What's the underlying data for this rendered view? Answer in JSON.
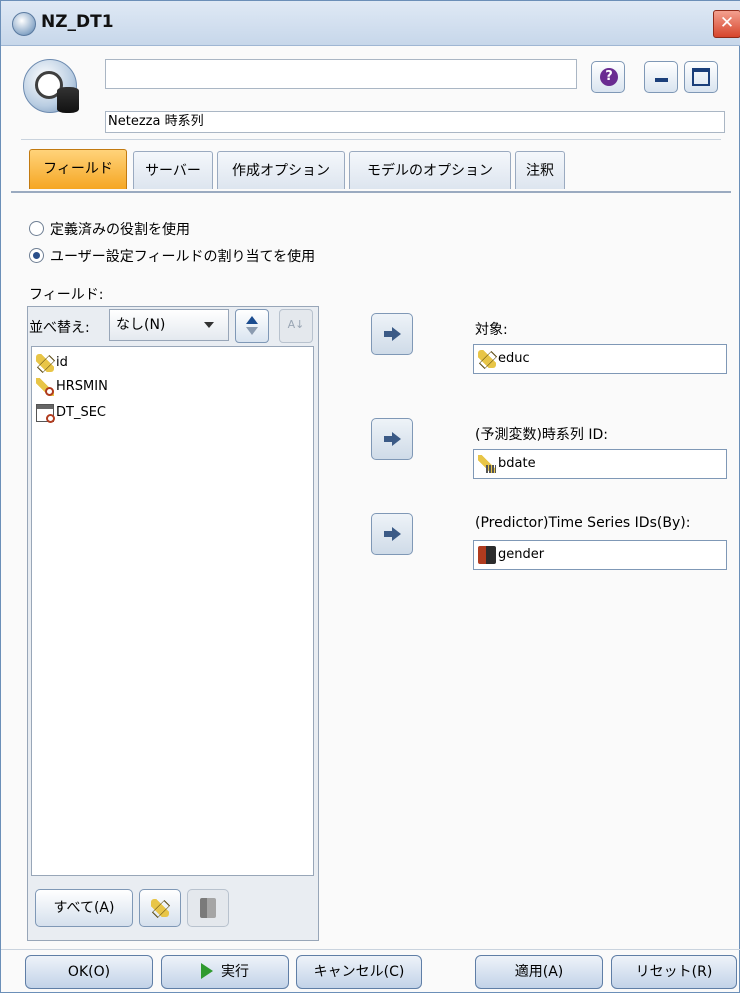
{
  "window": {
    "title": "NZ_DT1",
    "close_glyph": "✕"
  },
  "header": {
    "node_name_value": "",
    "node_type_label": "Netezza 時系列",
    "help_glyph": "?"
  },
  "tabs": [
    {
      "label": "フィールド",
      "active": true
    },
    {
      "label": "サーバー"
    },
    {
      "label": "作成オプション"
    },
    {
      "label": "モデルのオプション"
    },
    {
      "label": "注釈"
    }
  ],
  "roles": {
    "predefined": "定義済みの役割を使用",
    "custom": "ユーザー設定フィールドの割り当てを使用"
  },
  "fields_panel": {
    "label": "フィールド:",
    "sort_label": "並べ替え:",
    "sort_value": "なし(N)",
    "az_glyph": "A↓",
    "items": [
      {
        "name": "id",
        "icon": "continuous-ruler-icon"
      },
      {
        "name": "HRSMIN",
        "icon": "ordinal-time-icon"
      },
      {
        "name": "DT_SEC",
        "icon": "calendar-time-icon"
      }
    ],
    "all_button": "すべて(A)"
  },
  "targets": {
    "target_label": "対象:",
    "target_value": "educ",
    "tsid_label": "(予測変数)時系列 ID:",
    "tsid_value": "bdate",
    "by_label": "(Predictor)Time Series IDs(By):",
    "by_value": "gender"
  },
  "footer": {
    "ok": "OK(O)",
    "run": "実行",
    "cancel": "キャンセル(C)",
    "apply": "適用(A)",
    "reset": "リセット(R)"
  }
}
